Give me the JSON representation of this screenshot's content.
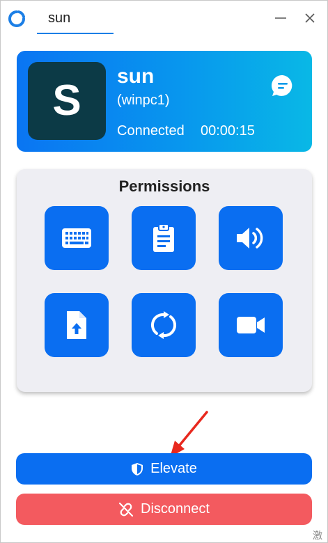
{
  "window": {
    "tab_title": "sun"
  },
  "session": {
    "avatar_letter": "S",
    "name": "sun",
    "host": "(winpc1)",
    "status": "Connected",
    "duration": "00:00:15"
  },
  "permissions": {
    "title": "Permissions",
    "items": [
      {
        "icon": "keyboard-icon"
      },
      {
        "icon": "clipboard-icon"
      },
      {
        "icon": "speaker-icon"
      },
      {
        "icon": "file-upload-icon"
      },
      {
        "icon": "restart-icon"
      },
      {
        "icon": "video-camera-icon"
      }
    ]
  },
  "actions": {
    "elevate_label": "Elevate",
    "disconnect_label": "Disconnect"
  },
  "corner_text": "激",
  "colors": {
    "primary": "#0a6ef1",
    "danger": "#f35a5f",
    "avatar_bg": "#0c3a46",
    "panel_bg": "#eeeef3",
    "annotation_arrow": "#e8281e"
  }
}
